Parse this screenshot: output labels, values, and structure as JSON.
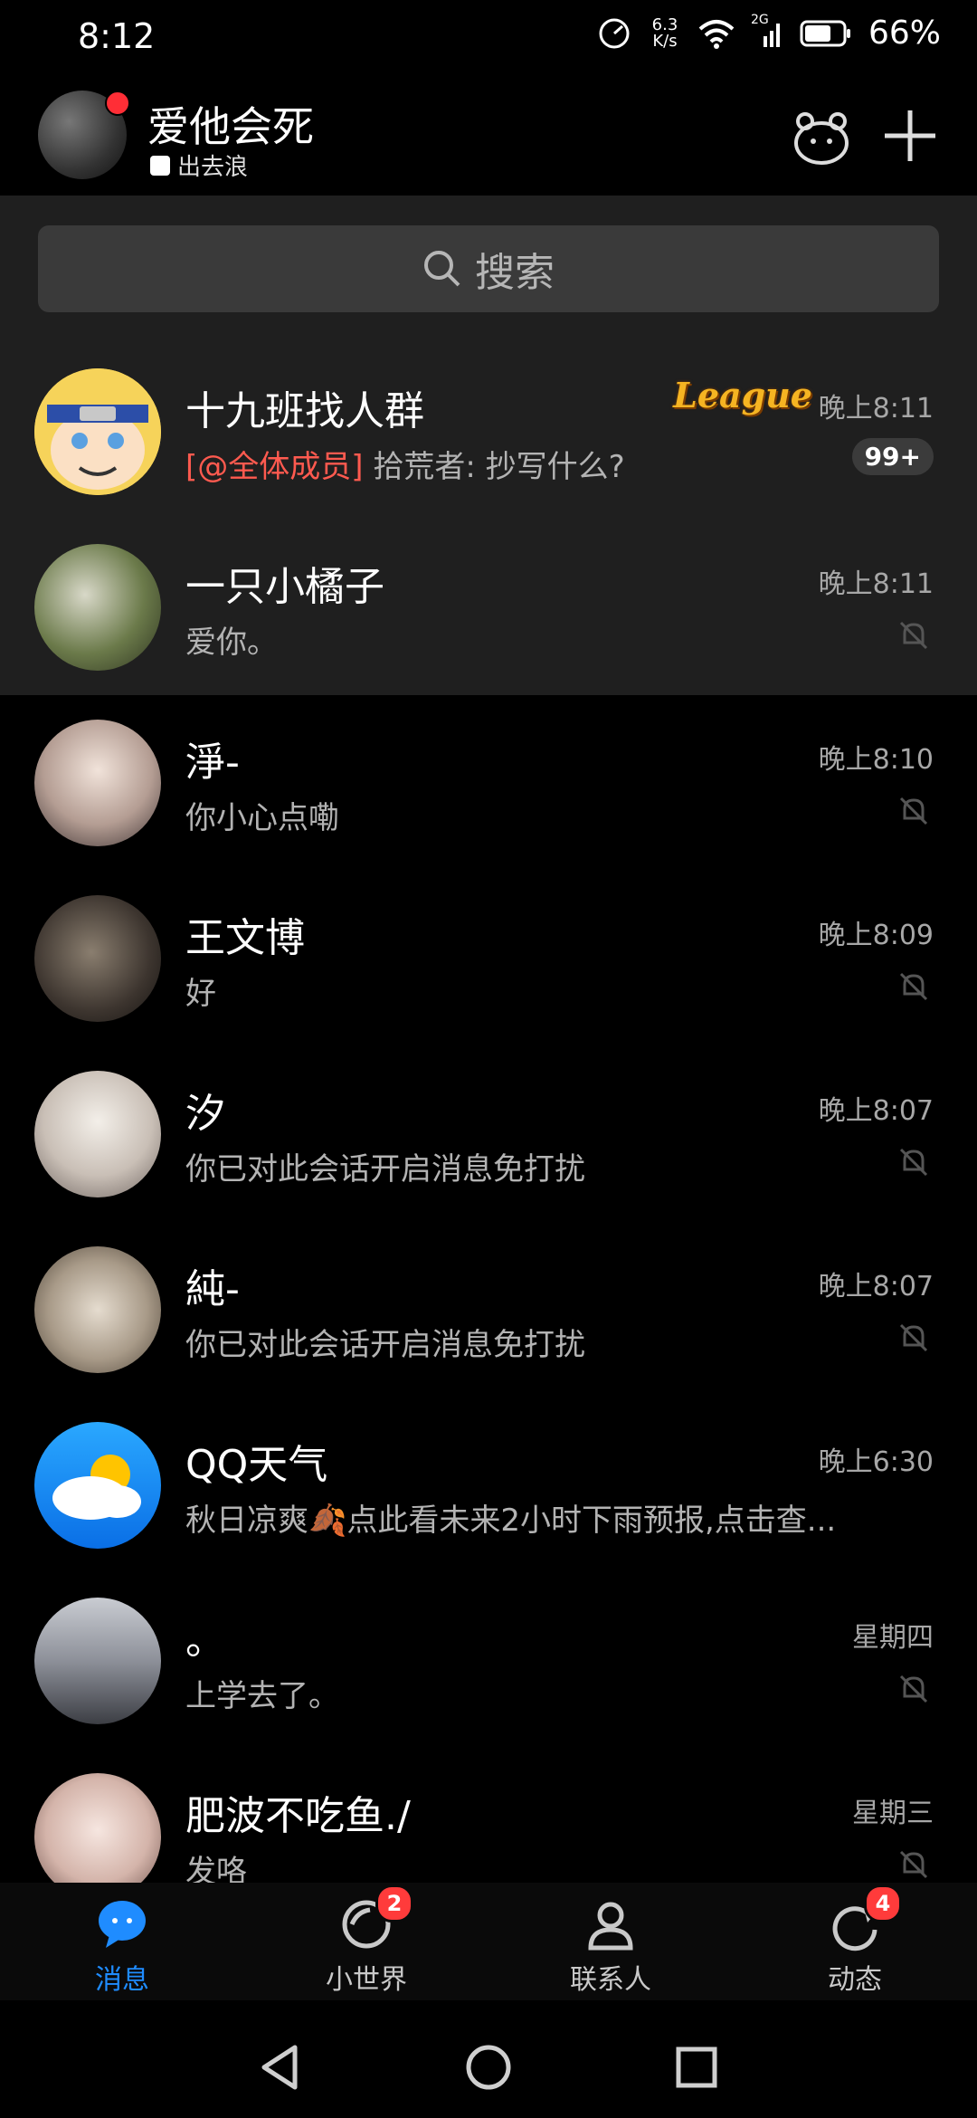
{
  "status_bar": {
    "time": "8:12",
    "net_speed_value": "6.3",
    "net_speed_unit": "K/s",
    "signal_label": "2G",
    "battery": "66%"
  },
  "header": {
    "nickname": "爱他会死",
    "status_text": "出去浪"
  },
  "search": {
    "placeholder": "搜索"
  },
  "conversations": [
    {
      "name": "十九班找人群",
      "mention": "[@全体成员]",
      "message": "拾荒者: 抄写什么?",
      "time": "晚上8:11",
      "unread": "99+",
      "tag": "League"
    },
    {
      "name": "一只小橘子",
      "message": "爱你。",
      "time": "晚上8:11"
    },
    {
      "name": "淨-",
      "message": "你小心点嘞",
      "time": "晚上8:10"
    },
    {
      "name": "王文博",
      "message": "好",
      "time": "晚上8:09"
    },
    {
      "name": "汐",
      "message": "你已对此会话开启消息免打扰",
      "time": "晚上8:07"
    },
    {
      "name": "純-",
      "message": "你已对此会话开启消息免打扰",
      "time": "晚上8:07"
    },
    {
      "name": "QQ天气",
      "message": "秋日凉爽🍂点此看未来2小时下雨预报,点击查...",
      "time": "晚上6:30"
    },
    {
      "name": "。",
      "message": "上学去了。",
      "time": "星期四"
    },
    {
      "name": "肥波不吃鱼./",
      "message": "发咯",
      "time": "星期三"
    }
  ],
  "tabs": [
    {
      "label": "消息",
      "badge": ""
    },
    {
      "label": "小世界",
      "badge": "2"
    },
    {
      "label": "联系人",
      "badge": ""
    },
    {
      "label": "动态",
      "badge": "4"
    }
  ],
  "colors": {
    "accent": "#1f8cff",
    "badge": "#ff3b3b",
    "mention": "#ff5a4f",
    "league": "#f5b422"
  }
}
